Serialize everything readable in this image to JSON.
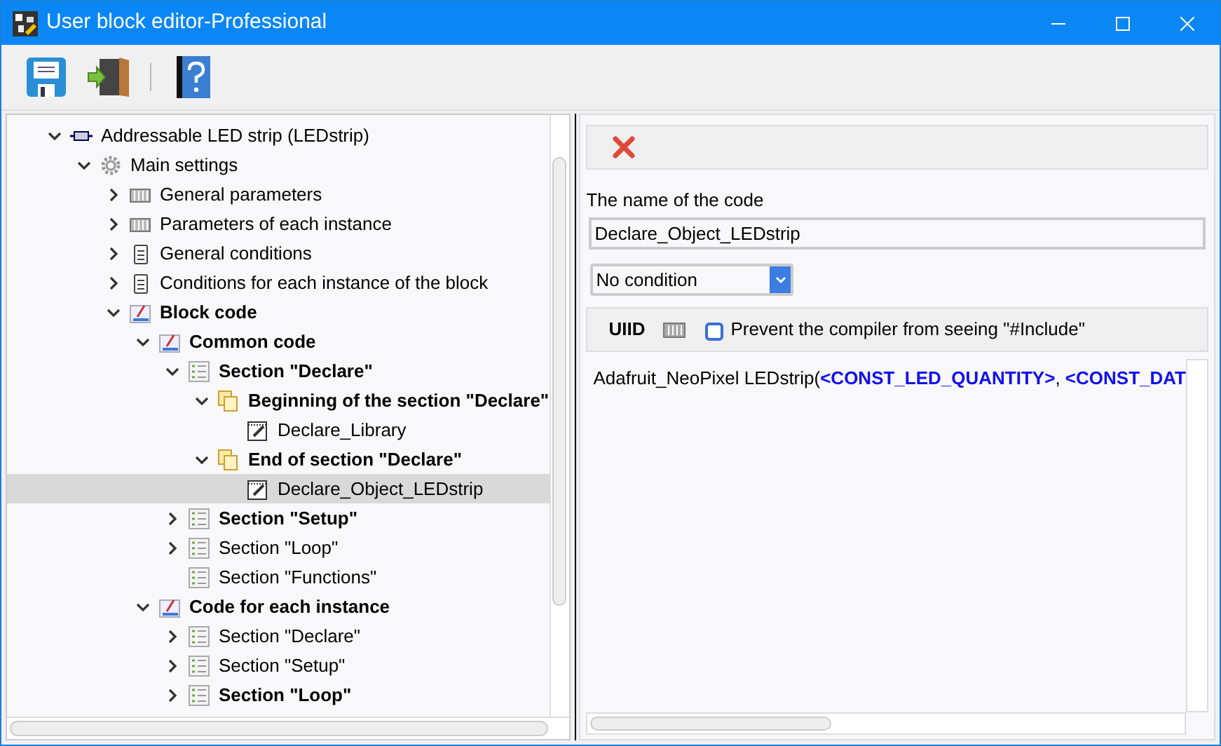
{
  "window": {
    "title": "User block editor-Professional"
  },
  "toolbar": [
    {
      "kind": "save"
    },
    {
      "kind": "exit"
    },
    {
      "kind": "help"
    }
  ],
  "tree": [
    {
      "label": "Addressable LED strip (LEDstrip)",
      "kind": "chip",
      "bold": false,
      "expanded": true,
      "selected": false,
      "children": [
        {
          "label": "Main settings",
          "kind": "gear",
          "bold": false,
          "expanded": true,
          "selected": false,
          "children": [
            {
              "label": "General parameters",
              "kind": "params",
              "bold": false,
              "expanded": false,
              "selected": false
            },
            {
              "label": "Parameters of each instance",
              "kind": "params",
              "bold": false,
              "expanded": false,
              "selected": false
            },
            {
              "label": "General conditions",
              "kind": "clipboard",
              "bold": false,
              "expanded": false,
              "selected": false
            },
            {
              "label": "Conditions for each instance of the block",
              "kind": "clipboard",
              "bold": false,
              "expanded": false,
              "selected": false
            },
            {
              "label": "Block code",
              "kind": "code",
              "bold": true,
              "expanded": true,
              "selected": false,
              "children": [
                {
                  "label": "Common code",
                  "kind": "code",
                  "bold": true,
                  "expanded": true,
                  "selected": false,
                  "children": [
                    {
                      "label": "Section \"Declare\"",
                      "kind": "list",
                      "bold": true,
                      "expanded": true,
                      "selected": false,
                      "children": [
                        {
                          "label": "Beginning of the section \"Declare\"",
                          "kind": "copy",
                          "bold": true,
                          "expanded": true,
                          "selected": false,
                          "children": [
                            {
                              "label": "Declare_Library",
                              "kind": "note",
                              "bold": false,
                              "selected": false
                            }
                          ]
                        },
                        {
                          "label": "End of section \"Declare\"",
                          "kind": "copy",
                          "bold": true,
                          "expanded": true,
                          "selected": false,
                          "children": [
                            {
                              "label": "Declare_Object_LEDstrip",
                              "kind": "note",
                              "bold": false,
                              "selected": true
                            }
                          ]
                        }
                      ]
                    },
                    {
                      "label": "Section \"Setup\"",
                      "kind": "list",
                      "bold": true,
                      "expanded": false,
                      "selected": false
                    },
                    {
                      "label": "Section \"Loop\"",
                      "kind": "list",
                      "bold": false,
                      "expanded": false,
                      "selected": false
                    },
                    {
                      "label": "Section \"Functions\"",
                      "kind": "list",
                      "bold": false,
                      "selected": false
                    }
                  ]
                },
                {
                  "label": "Code for each instance",
                  "kind": "code",
                  "bold": true,
                  "expanded": true,
                  "selected": false,
                  "children": [
                    {
                      "label": "Section \"Declare\"",
                      "kind": "list",
                      "bold": false,
                      "expanded": false,
                      "selected": false
                    },
                    {
                      "label": "Section \"Setup\"",
                      "kind": "list",
                      "bold": false,
                      "expanded": false,
                      "selected": false
                    },
                    {
                      "label": "Section \"Loop\"",
                      "kind": "list",
                      "bold": true,
                      "expanded": false,
                      "selected": false
                    }
                  ]
                }
              ]
            }
          ]
        }
      ]
    }
  ],
  "editor": {
    "name_label": "The name of the code",
    "name_value": "Declare_Object_LEDstrip",
    "condition": "No condition",
    "uiid_label": "UIID",
    "prevent_include": {
      "label": "Prevent the compiler from seeing \"#Include\"",
      "checked": false
    },
    "code": "Adafruit_NeoPixel LEDstrip(**<CONST_LED_QUANTITY>**, **<CONST_DAT**"
  }
}
